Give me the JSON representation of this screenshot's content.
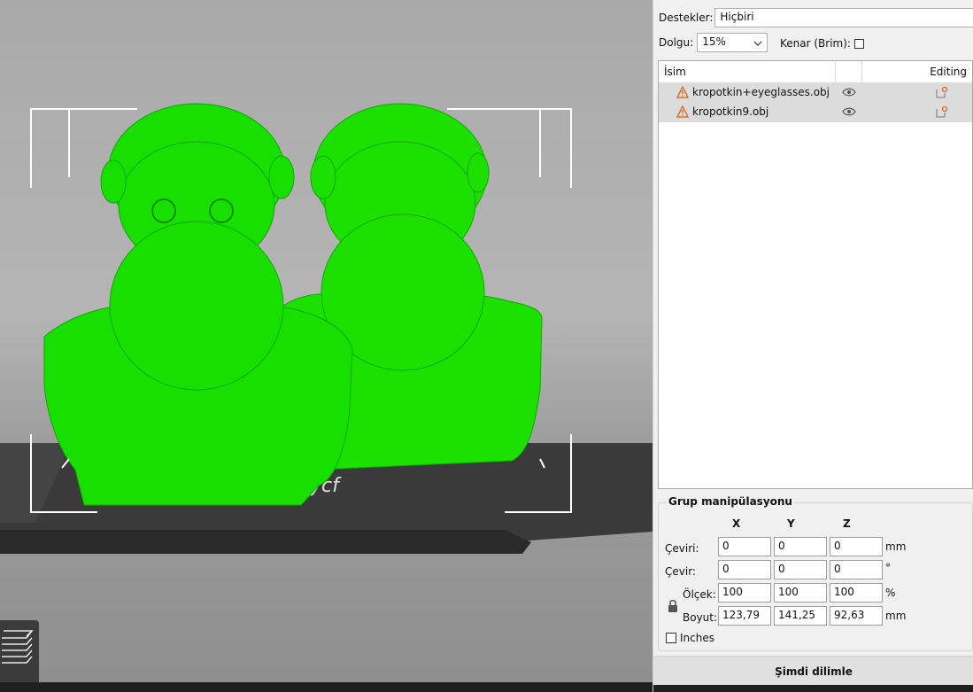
{
  "settings": {
    "supports_label": "Destekler:",
    "supports_value": "Hiçbiri",
    "infill_label": "Dolgu:",
    "infill_value": "15%",
    "brim_label": "Kenar (Brim):"
  },
  "object_list": {
    "col_name": "İsim",
    "col_editing": "Editing",
    "items": [
      {
        "name": "kropotkin+eyeglasses.obj"
      },
      {
        "name": "kropotkin9.obj"
      }
    ]
  },
  "group": {
    "title": "Grup manipülasyonu",
    "axes": [
      "X",
      "Y",
      "Z"
    ],
    "translate": {
      "label": "Çeviri:",
      "values": [
        "0",
        "0",
        "0"
      ],
      "unit": "mm"
    },
    "rotate": {
      "label": "Çevir:",
      "values": [
        "0",
        "0",
        "0"
      ],
      "unit": "°"
    },
    "scale": {
      "label": "Ölçek:",
      "values": [
        "100",
        "100",
        "100"
      ],
      "unit": "%"
    },
    "size": {
      "label": "Boyut:",
      "values": [
        "123,79",
        "141,25",
        "92,63"
      ],
      "unit": "mm"
    },
    "inches_label": "Inches"
  },
  "slice_button": "Şimdi dilimle",
  "viewport": {
    "model_color": "#18e100",
    "bed_color": "#333333"
  },
  "icons": {
    "warning": "warning-icon",
    "visibility": "eye-icon",
    "edit": "edit-icon",
    "lock": "lock-icon",
    "layers": "layers-icon",
    "dropdown": "chevron-down-icon"
  }
}
